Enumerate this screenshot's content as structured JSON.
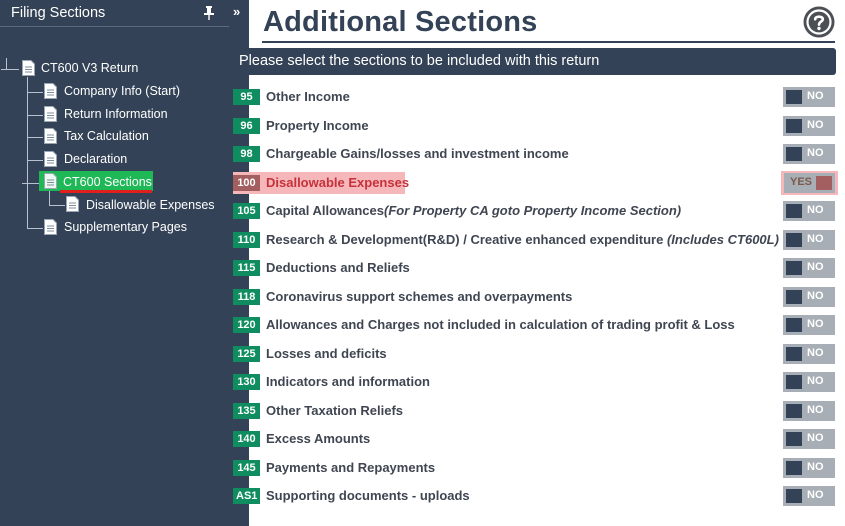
{
  "panel": {
    "title": "Filing Sections",
    "collapse_glyph": "»",
    "tree": {
      "root": "CT600 V3 Return",
      "items": [
        "Company Info (Start)",
        "Return Information",
        "Tax Calculation",
        "Declaration",
        "CT600 Sections",
        "Disallowable Expenses",
        "Supplementary Pages"
      ],
      "selected": "CT600 Sections"
    },
    "icons": [
      "pin-icon",
      "document-icon"
    ]
  },
  "main": {
    "title": "Additional Sections",
    "instruction": "Please select the sections to be included with this return",
    "help_icon": "question-circle-icon",
    "toggle_off": "NO",
    "toggle_on": "YES",
    "sections": [
      {
        "code": "95",
        "label": "Other Income",
        "note": "",
        "on": false
      },
      {
        "code": "96",
        "label": "Property Income",
        "note": "",
        "on": false
      },
      {
        "code": "98",
        "label": "Chargeable Gains/losses and investment income",
        "note": "",
        "on": false
      },
      {
        "code": "100",
        "label": "Disallowable Expenses",
        "note": "",
        "on": true
      },
      {
        "code": "105",
        "label": "Capital Allowances",
        "note": "(For Property CA goto Property Income Section)",
        "on": false
      },
      {
        "code": "110",
        "label": "Research & Development(R&D) / Creative enhanced expenditure ",
        "note": "(Includes CT600L)",
        "on": false
      },
      {
        "code": "115",
        "label": "Deductions and Reliefs",
        "note": "",
        "on": false
      },
      {
        "code": "118",
        "label": "Coronavirus support schemes and overpayments",
        "note": "",
        "on": false
      },
      {
        "code": "120",
        "label": "Allowances and Charges not included in calculation of trading profit & Loss",
        "note": "",
        "on": false
      },
      {
        "code": "125",
        "label": "Losses and deficits",
        "note": "",
        "on": false
      },
      {
        "code": "130",
        "label": "Indicators and information",
        "note": "",
        "on": false
      },
      {
        "code": "135",
        "label": "Other Taxation Reliefs",
        "note": "",
        "on": false
      },
      {
        "code": "140",
        "label": "Excess Amounts",
        "note": "",
        "on": false
      },
      {
        "code": "145",
        "label": "Payments and Repayments",
        "note": "",
        "on": false
      },
      {
        "code": "AS1",
        "label": "Supporting documents - uploads",
        "note": "",
        "on": false
      }
    ]
  },
  "colors": {
    "panel_bg": "#334256",
    "badge_green": "#108d60",
    "selected_row": "#f6b7bb",
    "selected_text": "#c5323a",
    "tree_selected": "#1fb856",
    "toggle_bg": "#a8aeb5"
  }
}
